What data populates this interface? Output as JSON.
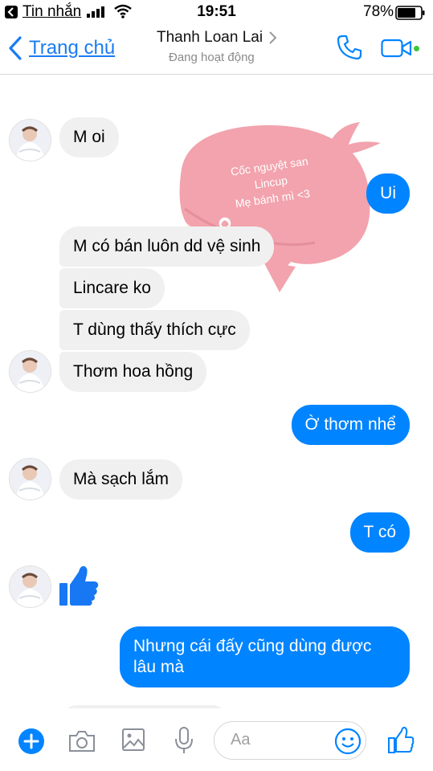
{
  "status": {
    "back_app": "Tin nhắn",
    "time": "19:51",
    "battery": "78%"
  },
  "header": {
    "back_label": "Trang chủ",
    "contact_name": "Thanh Loan Lai",
    "presence": "Đang hoạt động"
  },
  "sticker": {
    "lines": [
      "Cốc nguyệt san",
      "Lincup",
      "Mẹ bánh mì <3"
    ]
  },
  "messages": [
    {
      "from": "them",
      "text": "M oi"
    },
    {
      "from": "me",
      "text": "Ui"
    },
    {
      "from": "them",
      "text": "M có bán luôn dd vệ sinh"
    },
    {
      "from": "them",
      "text": "Lincare ko"
    },
    {
      "from": "them",
      "text": "T dùng thấy thích cực"
    },
    {
      "from": "them",
      "text": "Thơm hoa hồng"
    },
    {
      "from": "me",
      "text": "Ờ thơm nhể"
    },
    {
      "from": "them",
      "text": "Mà sạch lắm"
    },
    {
      "from": "me",
      "text": "T có"
    },
    {
      "from": "them",
      "type": "like",
      "icon": "thumbs-up-icon"
    },
    {
      "from": "me",
      "text": "Nhưng cái đấy cũng dùng được",
      "text2": "lâu mà"
    }
  ],
  "composer": {
    "placeholder": "Aa"
  },
  "colors": {
    "accent": "#0084ff",
    "incoming_bubble": "#f1f0f0",
    "sticker_pink": "#f2a3ad",
    "online": "#3cc43c"
  }
}
